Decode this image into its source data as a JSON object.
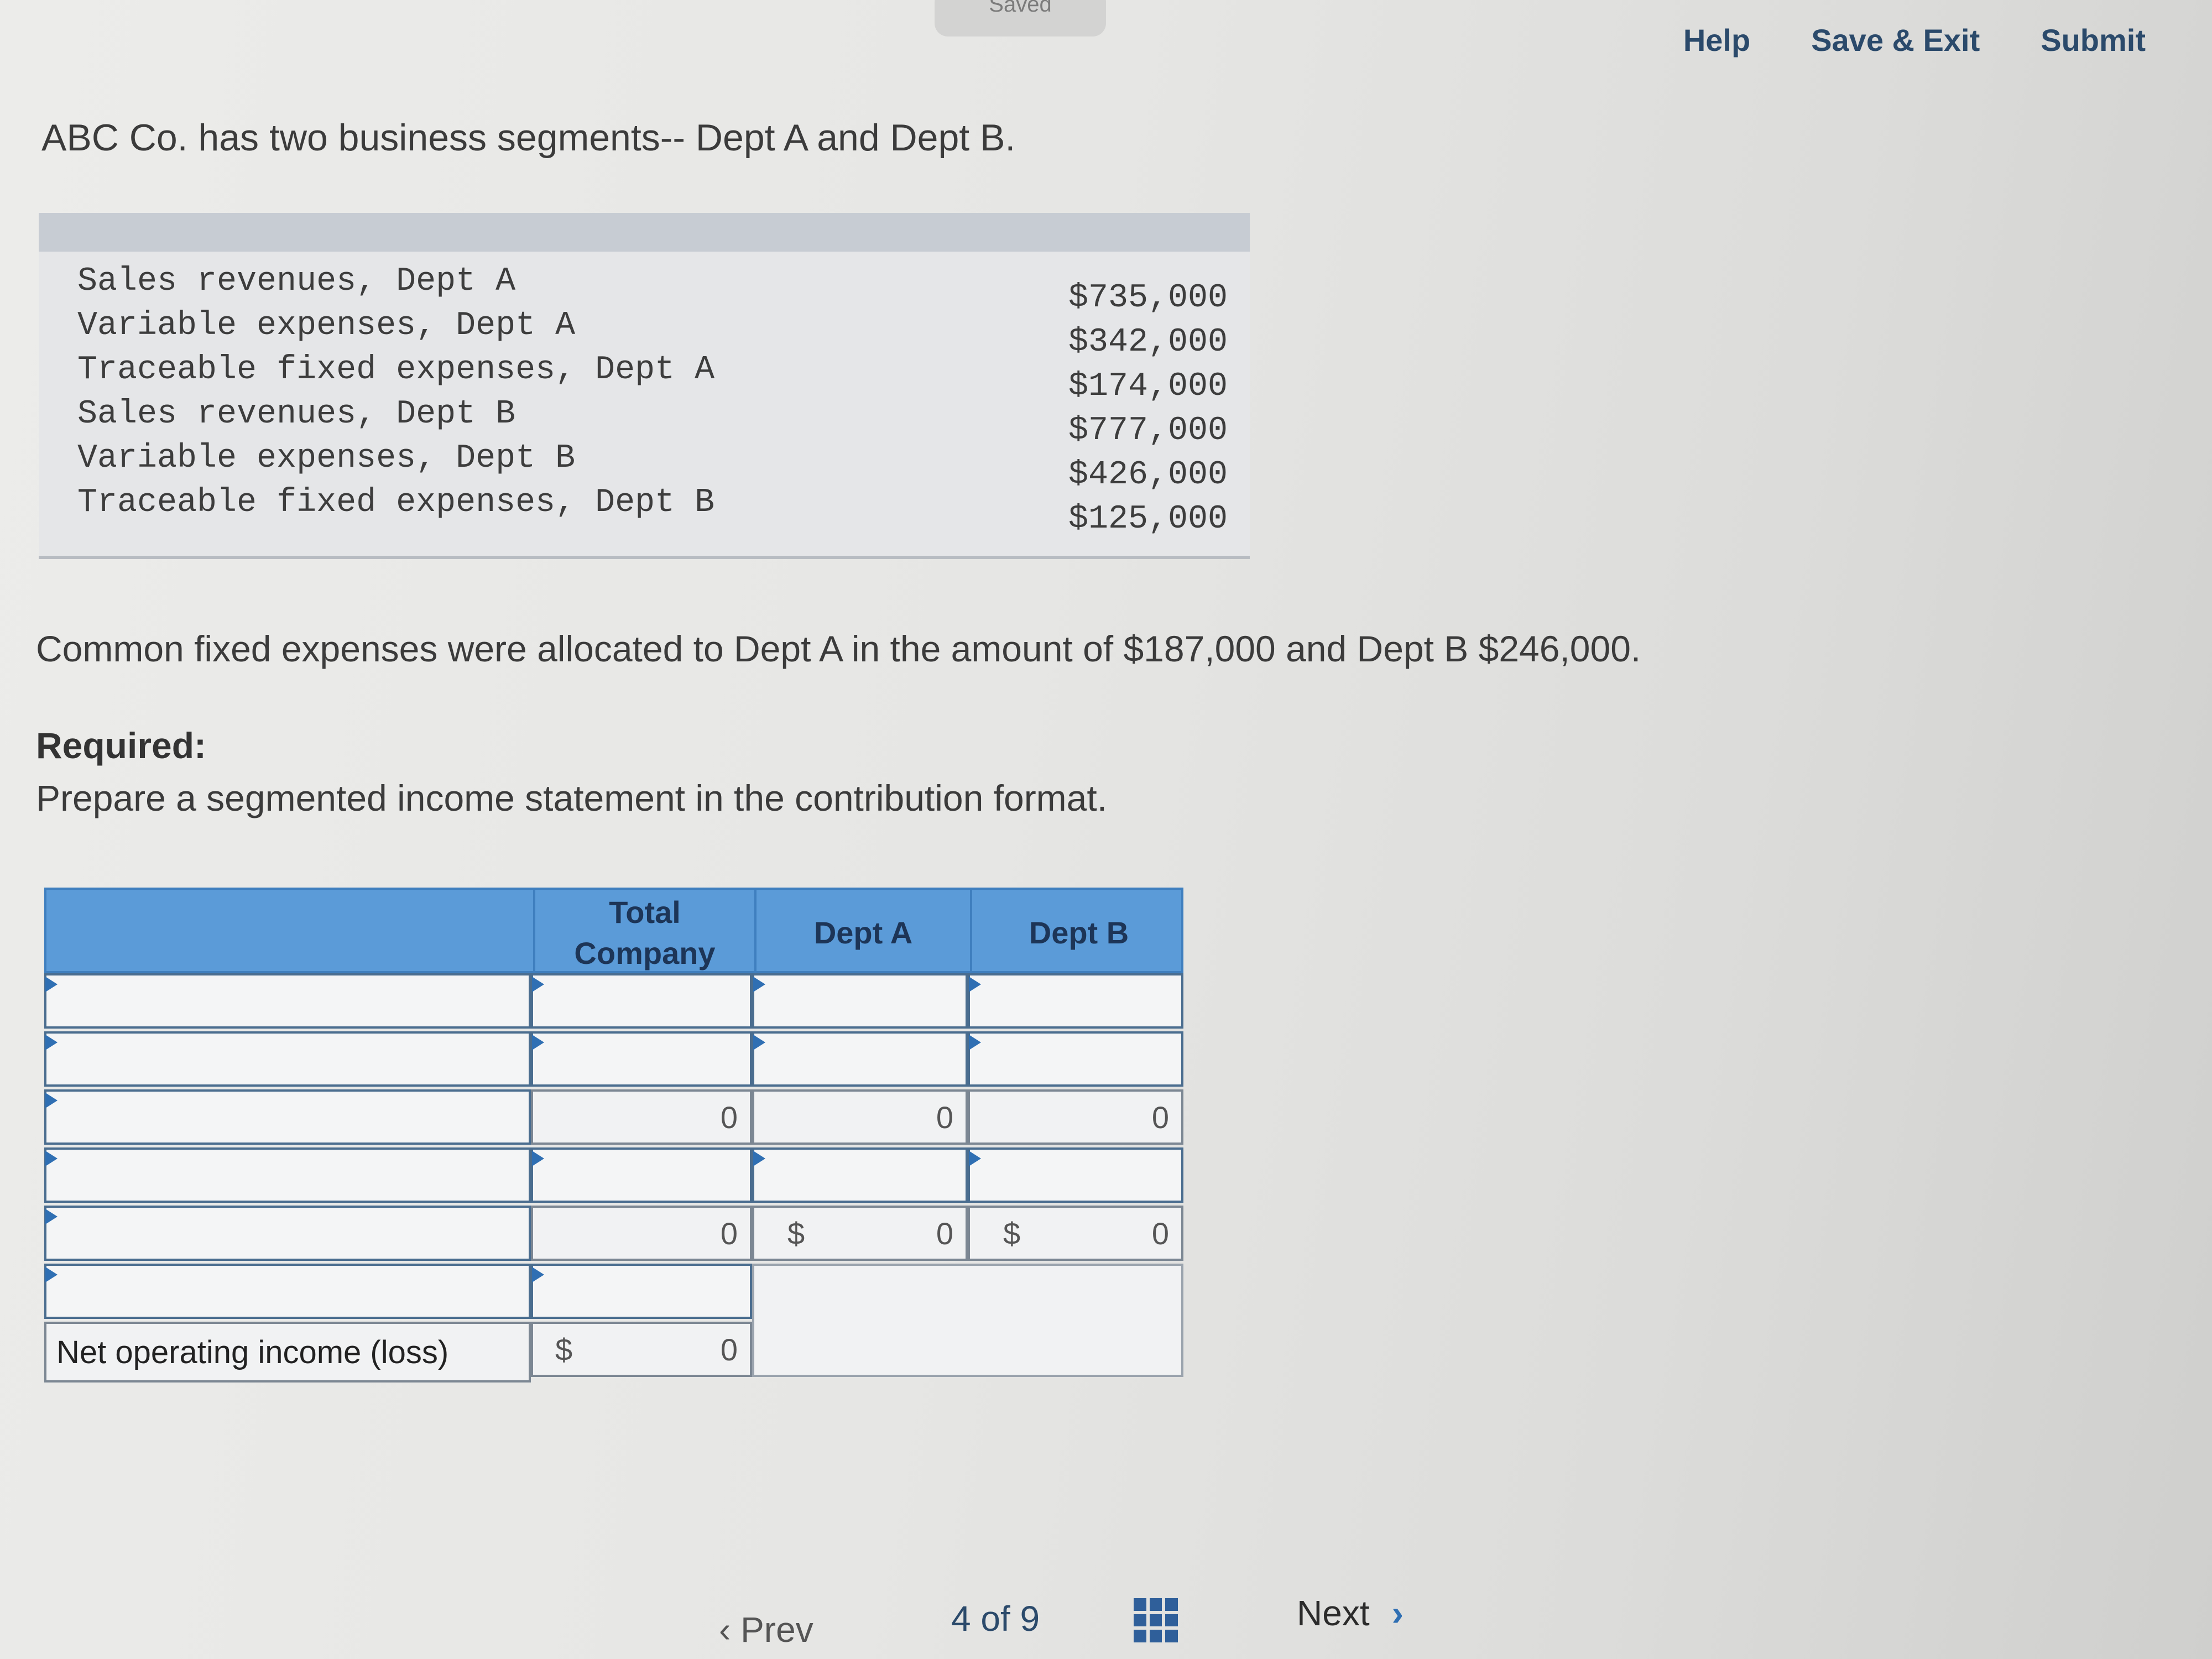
{
  "status": {
    "saved_label": "Saved"
  },
  "topnav": {
    "help": "Help",
    "save_exit": "Save & Exit",
    "submit": "Submit"
  },
  "intro": "ABC Co. has two business segments-- Dept A and Dept B.",
  "given": [
    {
      "label": "Sales revenues, Dept A",
      "value": "$735,000"
    },
    {
      "label": "Variable expenses, Dept A",
      "value": "$342,000"
    },
    {
      "label": "Traceable fixed expenses, Dept A",
      "value": "$174,000"
    },
    {
      "label": "Sales revenues, Dept B",
      "value": "$777,000"
    },
    {
      "label": "Variable expenses, Dept B",
      "value": "$426,000"
    },
    {
      "label": "Traceable fixed expenses, Dept B",
      "value": "$125,000"
    }
  ],
  "common_text": "Common fixed expenses were allocated to Dept A in the amount of $187,000 and Dept B $246,000.",
  "required": {
    "heading": "Required:",
    "text": "Prepare a segmented income statement in the contribution format."
  },
  "worksheet": {
    "headers": {
      "total_company": "Total Company",
      "dept_a": "Dept A",
      "dept_b": "Dept B"
    },
    "zero": "0",
    "dollar": "$",
    "net_label": "Net operating income (loss)"
  },
  "footer": {
    "prev": "Prev",
    "page_current": "4",
    "page_of": "of",
    "page_total": "9",
    "next": "Next"
  }
}
